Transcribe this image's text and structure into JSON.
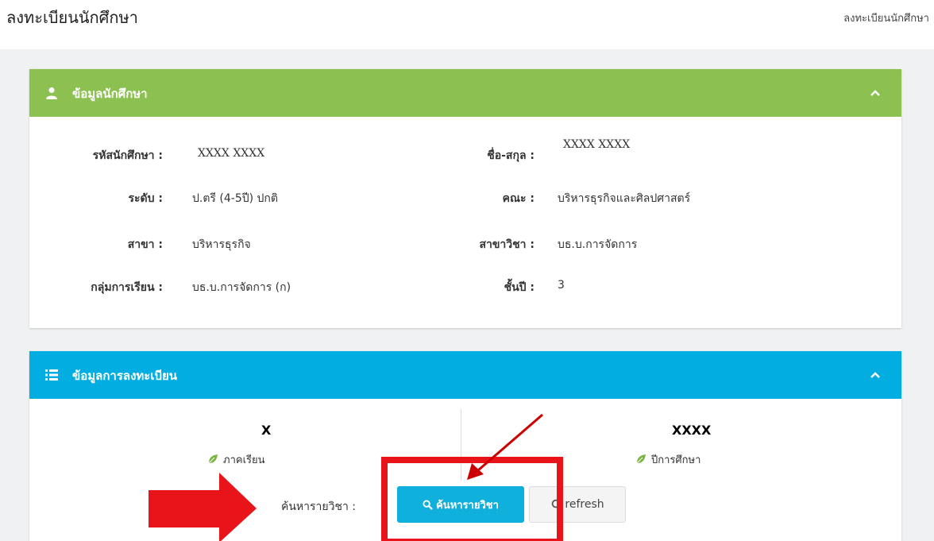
{
  "header": {
    "page_title": "ลงทะเบียนนักศึกษา",
    "breadcrumb": "ลงทะเบียนนักศึกษา"
  },
  "student_box": {
    "title": "ข้อมูลนักศึกษา",
    "collapse_icon": "chevron-up-icon",
    "fields": {
      "student_id": {
        "label": "รหัสนักศึกษา :",
        "value": "XXXX  XXXX"
      },
      "full_name": {
        "label": "ชื่อ-สกุล :",
        "value": "XXXX  XXXX"
      },
      "level": {
        "label": "ระดับ :",
        "value": "ป.ตรี (4-5ปี) ปกติ"
      },
      "faculty": {
        "label": "คณะ :",
        "value": "บริหารธุรกิจและศิลปศาสตร์"
      },
      "branch": {
        "label": "สาขา :",
        "value": "บริหารธุรกิจ"
      },
      "major": {
        "label": "สาขาวิชา :",
        "value": "บธ.บ.การจัดการ"
      },
      "group": {
        "label": "กลุ่มการเรียน :",
        "value": "บธ.บ.การจัดการ (ก)"
      },
      "year": {
        "label": "ชั้นปี :",
        "value": "3"
      }
    }
  },
  "registration_box": {
    "title": "ข้อมูลการลงทะเบียน",
    "collapse_icon": "chevron-up-icon",
    "semester": {
      "value": "X",
      "label": "ภาคเรียน"
    },
    "academic_year": {
      "value": "XXXX",
      "label": "ปีการศึกษา"
    },
    "search_label": "ค้นหารายวิชา :",
    "search_button": "ค้นหารายวิชา",
    "refresh_button": "refresh"
  },
  "colors": {
    "student_header": "#8cc152",
    "registration_header": "#02aee1",
    "search_button": "#0fb0dc",
    "annotation": "#e8141a"
  }
}
